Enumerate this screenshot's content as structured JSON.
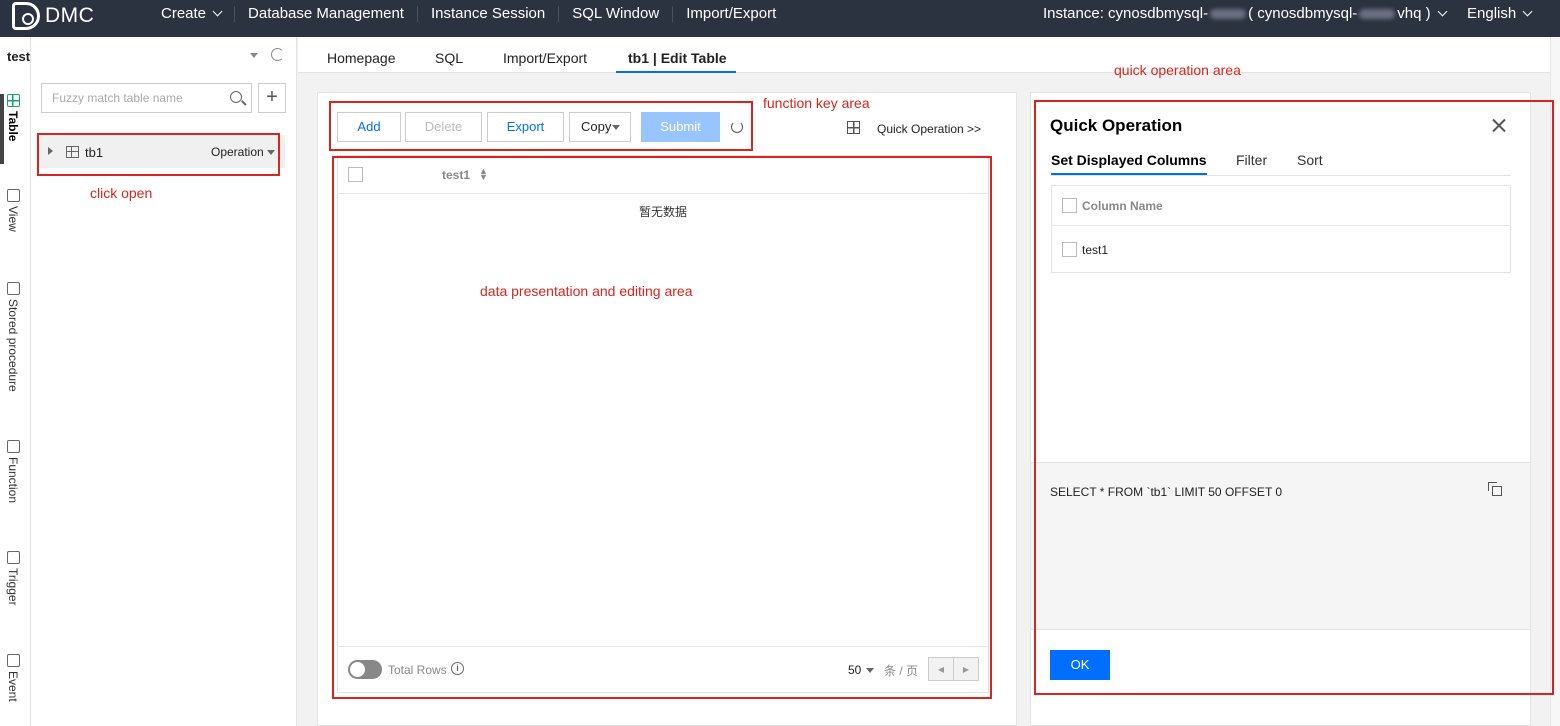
{
  "app": {
    "logo_text": "DMC"
  },
  "topnav": {
    "items": [
      {
        "label": "Create",
        "has_dropdown": true
      },
      {
        "label": "Database Management",
        "has_dropdown": false
      },
      {
        "label": "Instance Session",
        "has_dropdown": false
      },
      {
        "label": "SQL Window",
        "has_dropdown": false
      },
      {
        "label": "Import/Export",
        "has_dropdown": false
      }
    ],
    "instance_prefix": "Instance: cynosdbmysql-",
    "instance_middle": " ( cynosdbmysql-",
    "instance_suffix": "vhq )",
    "language": "English"
  },
  "vtabs": [
    {
      "label": "Table",
      "active": true
    },
    {
      "label": "View",
      "active": false
    },
    {
      "label": "Stored procedure",
      "active": false
    },
    {
      "label": "Function",
      "active": false
    },
    {
      "label": "Trigger",
      "active": false
    },
    {
      "label": "Event",
      "active": false
    }
  ],
  "dbpanel": {
    "database": "test",
    "search_placeholder": "Fuzzy match table name",
    "add_symbol": "+",
    "tree": [
      {
        "name": "tb1",
        "operation_label": "Operation"
      }
    ]
  },
  "tabs": [
    {
      "label": "Homepage",
      "active": false
    },
    {
      "label": "SQL",
      "active": false
    },
    {
      "label": "Import/Export",
      "active": false
    },
    {
      "label": "tb1 | Edit Table",
      "active": true
    }
  ],
  "toolbar": {
    "add": "Add",
    "delete": "Delete",
    "export": "Export",
    "copy": "Copy",
    "submit": "Submit",
    "quick_operation": "Quick Operation >>"
  },
  "datatable": {
    "columns": [
      "test1"
    ],
    "empty_text": "暂无数据",
    "total_rows_label": "Total Rows",
    "page_size": "50",
    "per_page_label": "条 / 页"
  },
  "quick_operation": {
    "title": "Quick Operation",
    "tabs": [
      {
        "label": "Set Displayed Columns",
        "active": true
      },
      {
        "label": "Filter",
        "active": false
      },
      {
        "label": "Sort",
        "active": false
      }
    ],
    "column_header": "Column Name",
    "columns": [
      "test1"
    ],
    "sql": "SELECT * FROM `tb1` LIMIT 50 OFFSET 0",
    "ok_label": "OK"
  },
  "annotations": {
    "function_key_area": "function key area",
    "quick_operation_area": "quick operation area",
    "click_open": "click open",
    "data_area": "data presentation and editing area"
  },
  "colors": {
    "topbar_bg": "#2b3240",
    "accent_blue": "#006eff",
    "annotation_red": "#d9251d",
    "active_green": "#1aa36b"
  }
}
